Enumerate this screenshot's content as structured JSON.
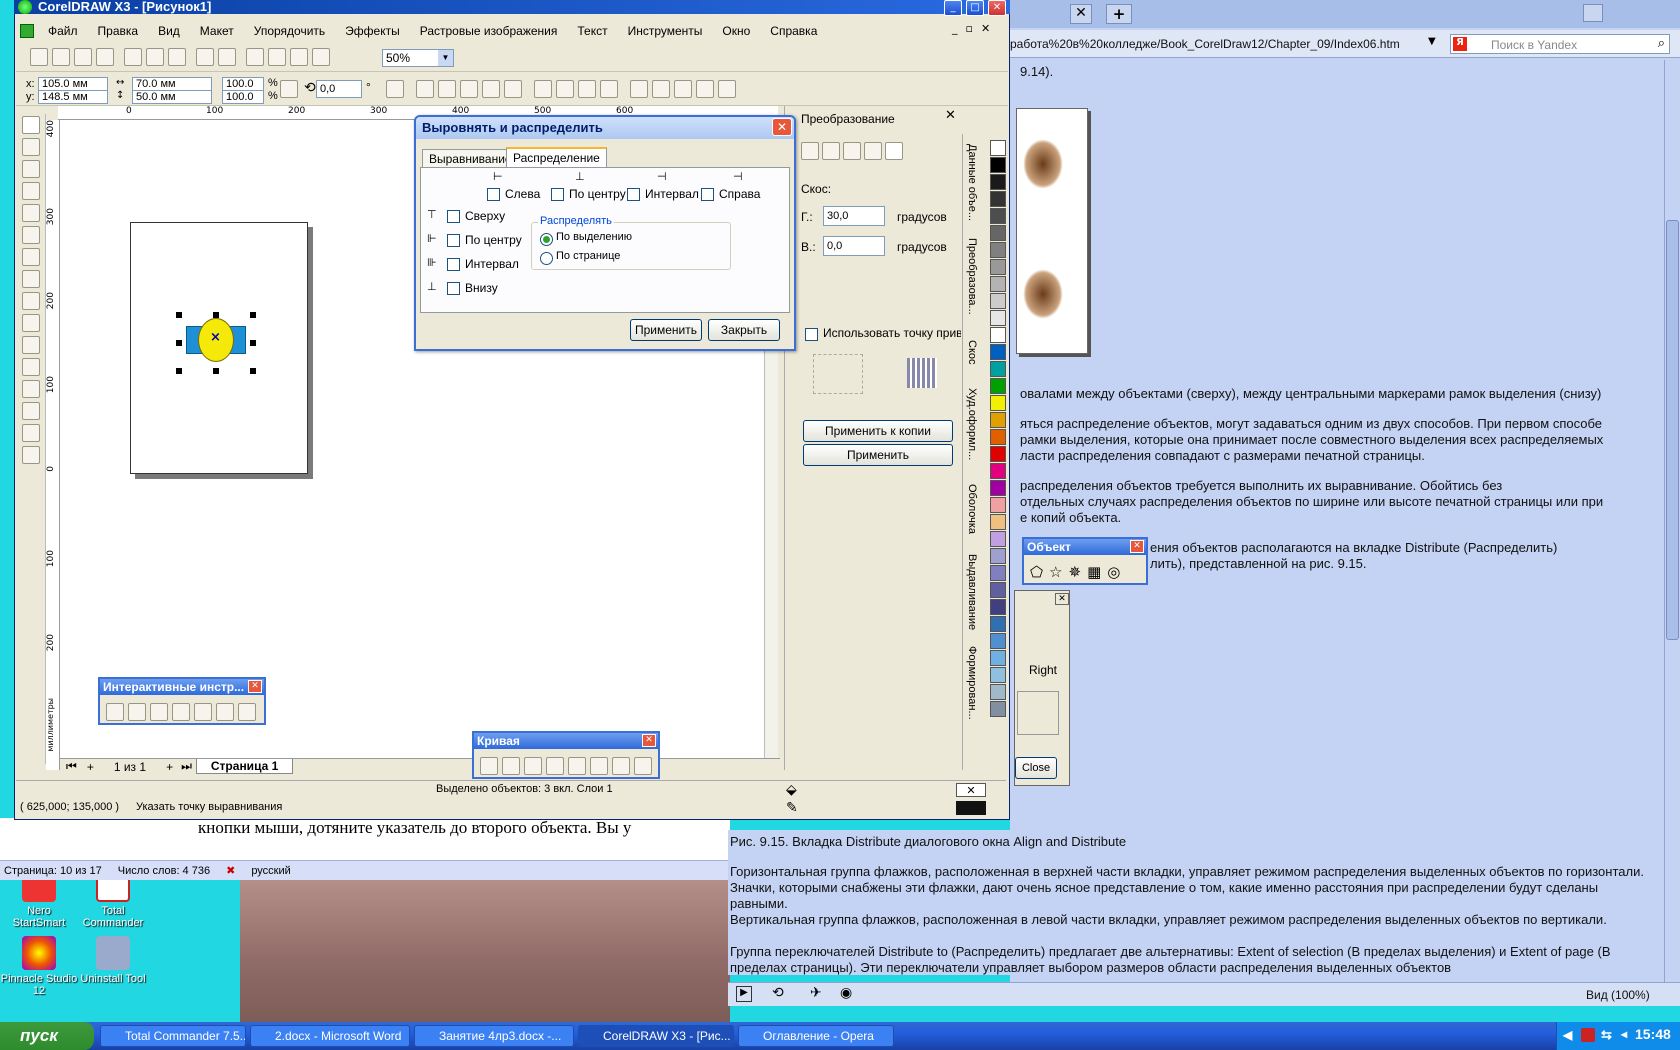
{
  "desktop": {
    "icons": [
      {
        "label": "Nero StartSmart"
      },
      {
        "label": "Total Commander"
      },
      {
        "label": "Pinnacle Studio 12"
      },
      {
        "label": "Uninstall Tool"
      }
    ],
    "word_text": "кнопки мыши, дотяните указатель до второго объекта. Вы у",
    "word_status": {
      "page": "Страница: 10 из 17",
      "words": "Число слов: 4 736",
      "lang": "русский"
    }
  },
  "corel": {
    "title": "CorelDRAW X3 - [Рисунок1]",
    "menu": [
      "Файл",
      "Правка",
      "Вид",
      "Макет",
      "Упорядочить",
      "Эффекты",
      "Растровые изображения",
      "Текст",
      "Инструменты",
      "Окно",
      "Справка"
    ],
    "zoom": "50%",
    "props": {
      "x": "105.0 мм",
      "y": "148.5 мм",
      "w": "70.0 мм",
      "h": "50.0 мм",
      "sx": "100.0",
      "sy": "100.0",
      "pct": "%",
      "angle": "0,0",
      "deg": "°"
    },
    "ruler_h": [
      "0",
      "100",
      "200",
      "300",
      "400",
      "500",
      "600"
    ],
    "ruler_v": [
      "400",
      "300",
      "200",
      "100",
      "0",
      "100",
      "200"
    ],
    "ruler_unit": "миллиметры",
    "page_nav": {
      "counter": "1 из 1",
      "page_tab": "Страница 1"
    },
    "status": {
      "coords": "( 625,000; 135,000 )",
      "hint": "Указать точку выравнивания",
      "selected": "Выделено объектов: 3 вкл. Слои 1"
    }
  },
  "transform_docker": {
    "title": "Преобразование",
    "skew_label": "Скос:",
    "h_label": "Г.:",
    "h_value": "30,0",
    "v_label": "В.:",
    "v_value": "0,0",
    "unit": "градусов",
    "anchor_label": "Использовать точку привязки",
    "apply_copy": "Применить к копии",
    "apply": "Применить",
    "side_tabs": [
      "Данные объе...",
      "Преобразова...",
      "Скос",
      "Худ.оформл...",
      "Оболочка",
      "Выдавливание",
      "Формирован..."
    ]
  },
  "dialog": {
    "title": "Выровнять и распределить",
    "tabs": [
      "Выравнивание",
      "Распределение"
    ],
    "h_options": [
      "Слева",
      "По центру",
      "Интервал",
      "Справа"
    ],
    "v_options": [
      "Сверху",
      "По центру",
      "Интервал",
      "Внизу"
    ],
    "group_title": "Распределять",
    "radios": [
      "По выделению",
      "По странице"
    ],
    "apply": "Применить",
    "close": "Закрыть"
  },
  "interactive_tb": {
    "title": "Интерактивные инстр..."
  },
  "curve_tb": {
    "title": "Кривая"
  },
  "object_tb": {
    "title": "Объект"
  },
  "opera": {
    "address": "работа%20в%20колледже/Book_CorelDraw12/Chapter_09/Index06.htm",
    "search_placeholder": "Поиск в Yandex",
    "fig_ref": "9.14).",
    "paragraphs": [
      "овалами между объектами (сверху), между центральными маркерами рамок выделения (снизу)",
      "яться распределение объектов, могут задаваться одним из двух способов. При первом способе",
      "рамки выделения, которые она принимает после совместного выделения всех распределяемых",
      "ласти распределения совпадают с размерами печатной страницы.",
      "распределения объектов требуется выполнить их выравнивание. Обойтись без",
      "отдельных случаях распределения объектов по ширине или высоте печатной страницы или при",
      "е копий объекта.",
      "ения объектов располагаются на вкладке Distribute (Распределить)",
      "лить), представленной на рис. 9.15."
    ],
    "inner_right": "Right",
    "inner_close": "Close",
    "caption": "Рис. 9.15. Вкладка Distribute диалогового окна Align and Distribute",
    "body": [
      "Горизонтальная группа флажков, расположенная в верхней части вкладки, управляет режимом распределения выделенных объектов по горизонтали. Значки, которыми снабжены эти флажки, дают очень ясное представление о том, какие именно расстояния при распределении будут сделаны равными.",
      "Вертикальная группа флажков, расположенная в левой части вкладки, управляет режимом распределения выделенных объектов по вертикали.",
      "Группа переключателей Distribute to (Распределить) предлагает две альтернативы: Extent of selection (В пределах выделения) и Extent of page (В пределах страницы). Эти переключатели управляет выбором размеров области распределения выделенных объектов"
    ],
    "view_zoom": "Вид (100%)"
  },
  "taskbar": {
    "start": "пуск",
    "tasks": [
      "Total Commander 7.5...",
      "2.docx - Microsoft Word",
      "Занятие 4лр3.docx -...",
      "CorelDRAW X3 - [Рис...",
      "Оглавление - Opera"
    ],
    "clock": "15:48"
  },
  "colors": {
    "selection_rect": "#1e90d6",
    "ellipse": "#f5e90a",
    "xp_blue": "#245edb",
    "docker_bg": "#ece9d8"
  }
}
